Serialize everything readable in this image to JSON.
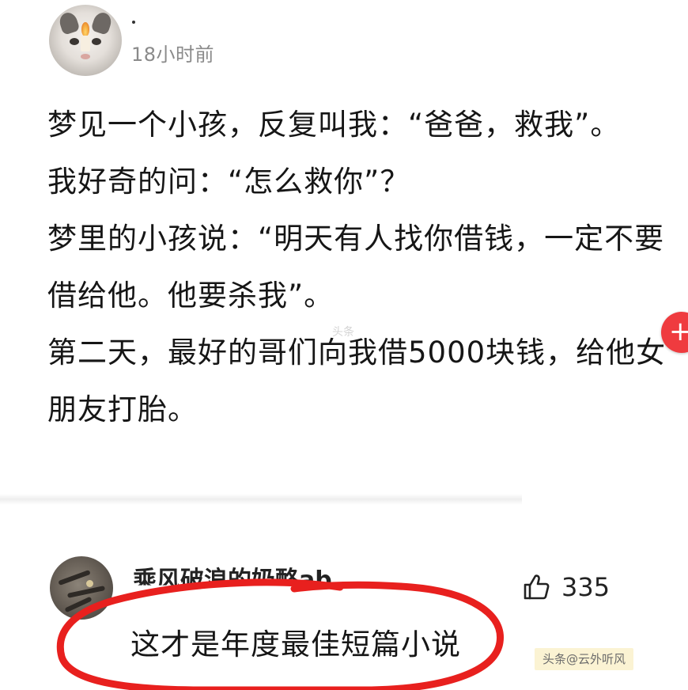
{
  "post": {
    "author_name": "·",
    "time": "18小时前",
    "lines": [
      "梦见一个小孩，反复叫我：“爸爸，救我”。",
      "我好奇的问：“怎么救你”？",
      "梦里的小孩说：“明天有人找你借钱，一定不要",
      "借给他。他要杀我”。",
      "第二天，最好的哥们向我借5000块钱，给他女",
      "朋友打胎。"
    ],
    "faint_watermark": "头条",
    "plus_badge": "+"
  },
  "comment": {
    "username": "乘风破浪的奶酪ab",
    "likes": "335",
    "text": "这才是年度最佳短篇小说",
    "highlight_color": "#e8201e"
  },
  "source_watermark": "头条@云外听风",
  "icons": {
    "like": "thumbs-up-icon",
    "add": "plus-icon"
  }
}
